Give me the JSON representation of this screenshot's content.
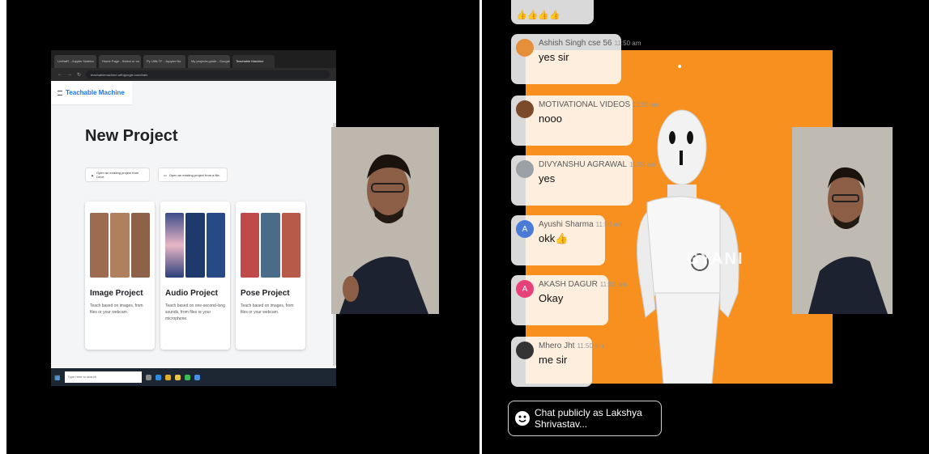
{
  "left": {
    "browser": {
      "tabs": [
        "LiviNaR - Jupyter Notebo",
        "Home Page - Select or co",
        "Py Utils TF - Jupyter No",
        "My projects guide - Google",
        "Teachable Machine"
      ],
      "address": "teachablemachine.withgoogle.com/train"
    },
    "app": {
      "brand": "Teachable Machine",
      "page_title": "New Project",
      "open_drive_label": "Open an existing project from Drive.",
      "open_file_label": "Open an existing project from a file.",
      "cards": [
        {
          "title": "Image Project",
          "desc": "Teach based on images, from files or your webcam."
        },
        {
          "title": "Audio Project",
          "desc": "Teach based on one-second-long sounds, from files or your microphone."
        },
        {
          "title": "Pose Project",
          "desc": "Teach based on images, from files or your webcam."
        }
      ]
    },
    "taskbar": {
      "search_placeholder": "Type here to search"
    }
  },
  "right": {
    "slide_watermark": "GYANI",
    "chat": [
      {
        "name": "Ashish Singh cse 56",
        "time": "11:50 am",
        "text": "yes sir",
        "avatar_color": "#e58f3a"
      },
      {
        "name": "MOTIVATIONAL VIDEOS",
        "time": "11:50 am",
        "text": "nooo",
        "avatar_color": "#7a4a2a"
      },
      {
        "name": "DIVYANSHU AGRAWAL",
        "time": "11:50 am",
        "text": "yes",
        "avatar_color": "#9aa0a6"
      },
      {
        "name": "Ayushi Sharma",
        "time": "11:50 am",
        "text": "okk👍",
        "avatar_color": "#4a7bd6",
        "initial": "A"
      },
      {
        "name": "AKASH DAGUR",
        "time": "11:50 am",
        "text": "Okay",
        "avatar_color": "#e8417a",
        "initial": "A"
      },
      {
        "name": "Mhero Jht",
        "time": "11:50 am",
        "text": "me sir",
        "avatar_color": "#333333"
      }
    ],
    "chat_input_placeholder": "Chat publicly as Lakshya Shrivastav..."
  }
}
